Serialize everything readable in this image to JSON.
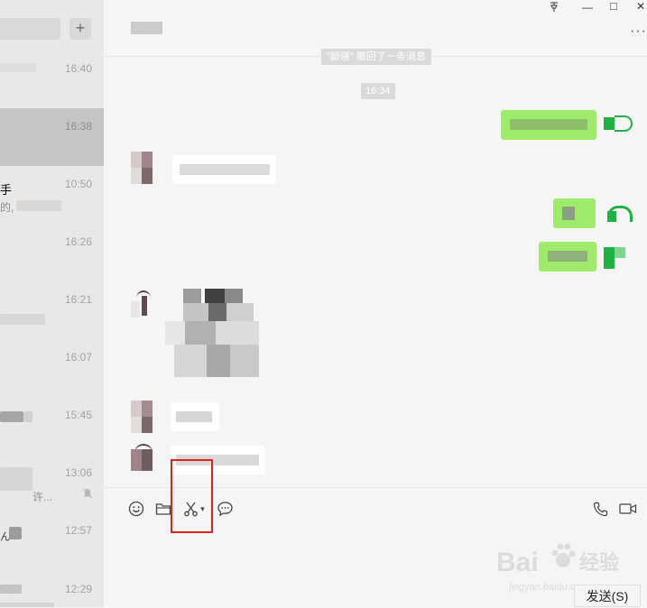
{
  "sidebar": {
    "add_label": "+",
    "conversations": [
      {
        "time": "16:40",
        "name": "",
        "preview": ""
      },
      {
        "time": "16:38",
        "name": "",
        "preview": "",
        "active": true
      },
      {
        "time": "10:50",
        "name": "手",
        "preview": "的,"
      },
      {
        "time": "16:26",
        "name": "",
        "preview": ""
      },
      {
        "time": "16:21",
        "name": "",
        "preview": ""
      },
      {
        "time": "16:07",
        "name": "",
        "preview": ""
      },
      {
        "time": "15:45",
        "name": "",
        "preview": ""
      },
      {
        "time": "13:06",
        "name": "",
        "preview": "许...",
        "muted": true
      },
      {
        "time": "12:57",
        "name": "",
        "preview": "ん"
      },
      {
        "time": "12:29",
        "name": "",
        "preview": ""
      }
    ]
  },
  "window": {
    "pin_icon": "pin-icon",
    "minimize_label": "—",
    "maximize_label": "□",
    "close_label": "✕"
  },
  "chat": {
    "more_label": "···",
    "system_message": "\"颜晓\" 撤回了一条消息",
    "time_tag": "16:34"
  },
  "toolbar": {
    "icons": [
      "emoji-icon",
      "folder-icon",
      "scissors-icon",
      "chat-history-icon",
      "phone-icon",
      "video-icon"
    ],
    "screenshot_dropdown": "▾",
    "send_label": "发送(S)"
  },
  "watermark": {
    "brand": "Bai",
    "sub": "经验",
    "url": "jingyan.baidu.com"
  },
  "colors": {
    "out_bubble": "#9eea6a",
    "highlight": "#e0201d",
    "sidebar": "#e9e8e8"
  }
}
